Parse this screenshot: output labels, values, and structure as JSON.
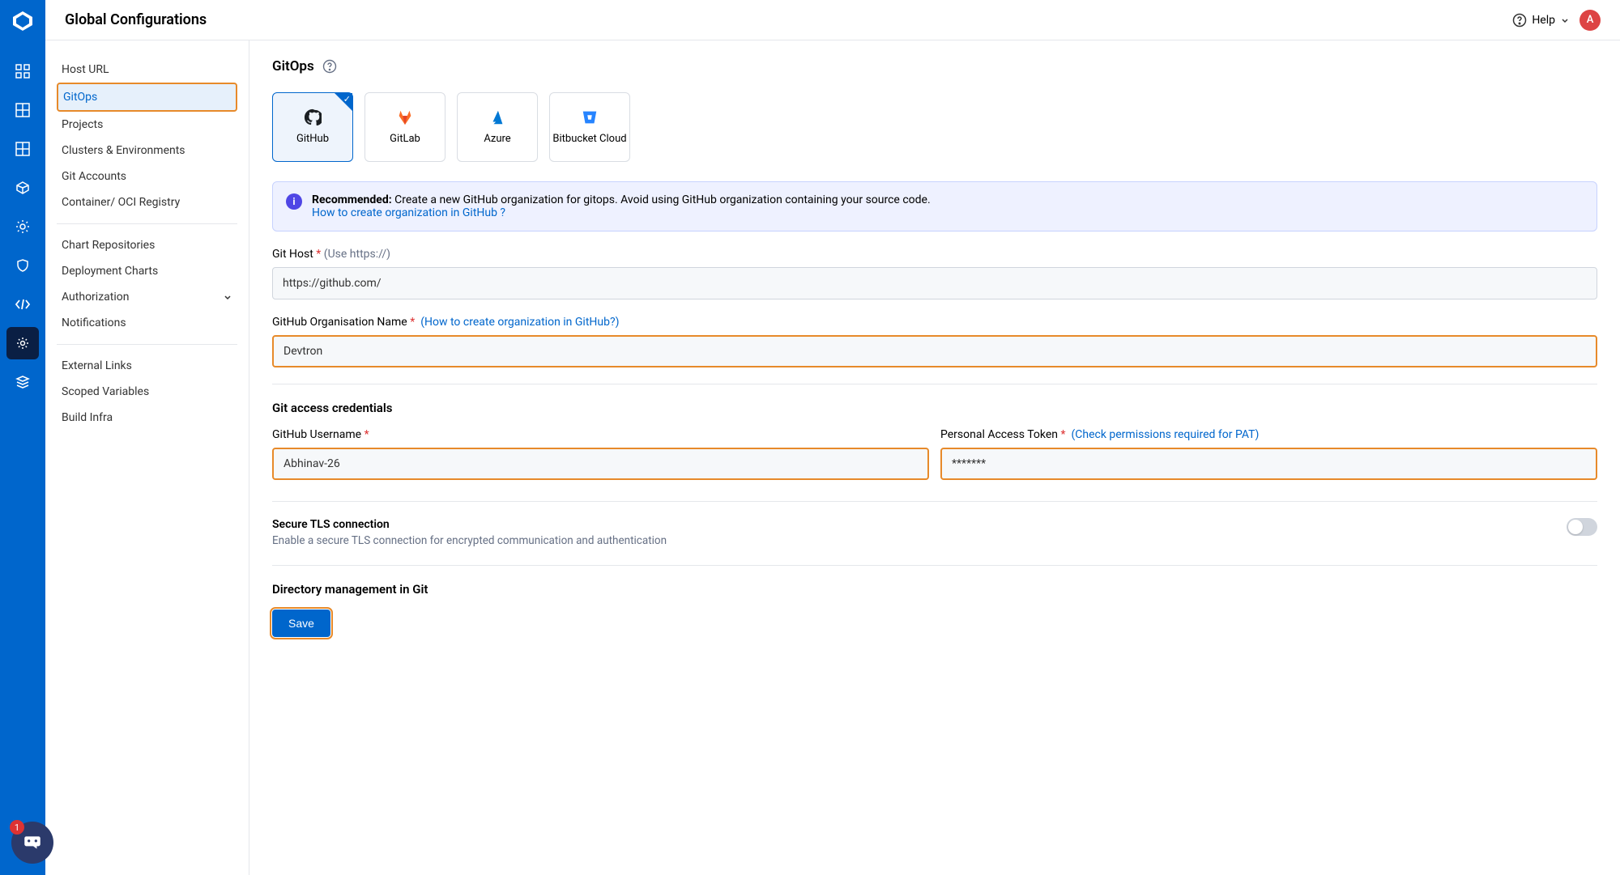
{
  "header": {
    "title": "Global Configurations",
    "help": "Help",
    "avatar": "A",
    "chat_badge": "1"
  },
  "sidebar": {
    "items": [
      {
        "label": "Host URL"
      },
      {
        "label": "GitOps",
        "active": true
      },
      {
        "label": "Projects"
      },
      {
        "label": "Clusters & Environments"
      },
      {
        "label": "Git Accounts"
      },
      {
        "label": "Container/ OCI Registry"
      }
    ],
    "items2": [
      {
        "label": "Chart Repositories"
      },
      {
        "label": "Deployment Charts"
      },
      {
        "label": "Authorization",
        "expandable": true
      },
      {
        "label": "Notifications"
      }
    ],
    "items3": [
      {
        "label": "External Links"
      },
      {
        "label": "Scoped Variables"
      },
      {
        "label": "Build Infra"
      }
    ]
  },
  "page": {
    "title": "GitOps",
    "providers": [
      {
        "label": "GitHub",
        "selected": true
      },
      {
        "label": "GitLab"
      },
      {
        "label": "Azure"
      },
      {
        "label": "Bitbucket Cloud"
      }
    ],
    "banner": {
      "label": "Recommended:",
      "text": "Create a new GitHub organization for gitops. Avoid using GitHub organization containing your source code.",
      "link": "How to create organization in GitHub ?"
    },
    "git_host": {
      "label": "Git Host",
      "hint": "(Use https://)",
      "value": "https://github.com/"
    },
    "org": {
      "label": "GitHub Organisation Name",
      "help": "(How to create organization in GitHub?)",
      "value": "Devtron"
    },
    "creds_title": "Git access credentials",
    "username": {
      "label": "GitHub Username",
      "value": "Abhinav-26"
    },
    "pat": {
      "label": "Personal Access Token",
      "help": "(Check permissions required for PAT)",
      "value": "*******"
    },
    "tls": {
      "title": "Secure TLS connection",
      "sub": "Enable a secure TLS connection for encrypted communication and authentication"
    },
    "dir_title": "Directory management in Git",
    "save": "Save"
  }
}
